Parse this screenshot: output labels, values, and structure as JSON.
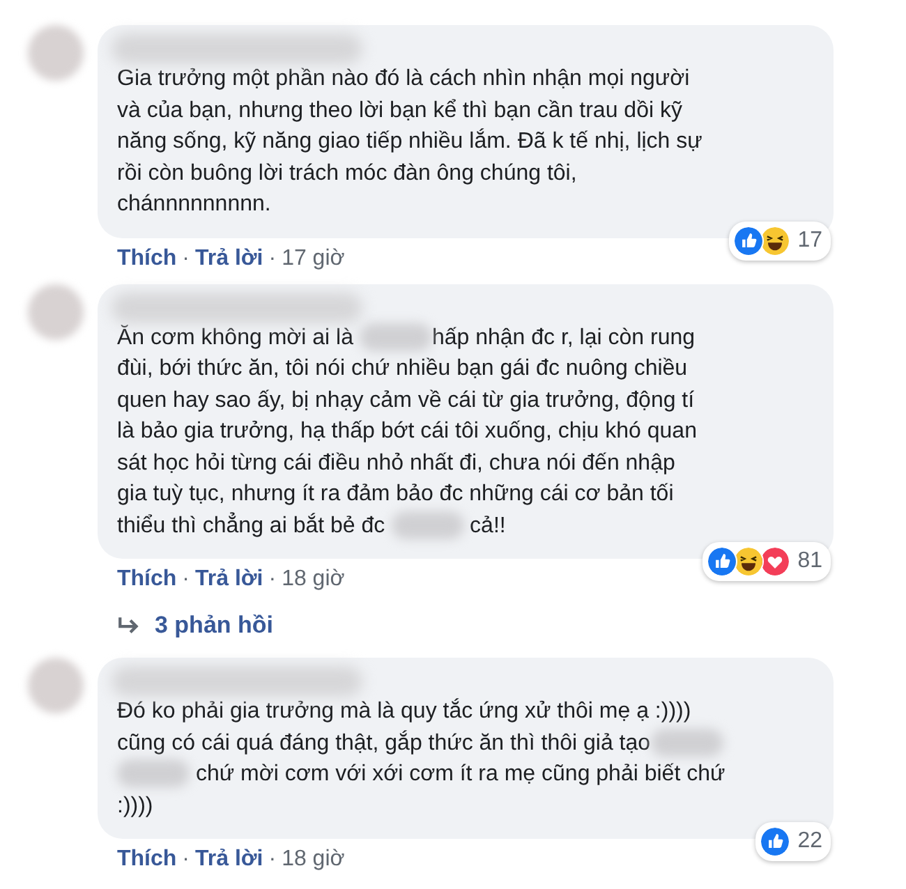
{
  "comments": [
    {
      "lines": [
        [
          {
            "kind": "text",
            "text": "Gia trưởng một phần nào đó là cách nhìn nhận mọi người"
          }
        ],
        [
          {
            "kind": "text",
            "text": "và của bạn, nhưng theo lời bạn kể thì bạn cần trau dồi kỹ"
          }
        ],
        [
          {
            "kind": "text",
            "text": "năng sống, kỹ năng giao tiếp nhiều lắm. Đã k tế nhị, lịch sự"
          }
        ],
        [
          {
            "kind": "text",
            "text": "rồi còn buông lời trách móc đàn ông chúng tôi,"
          }
        ],
        [
          {
            "kind": "text",
            "text": "chánnnnnnnnn."
          }
        ]
      ],
      "reactions": [
        {
          "kind": "like"
        },
        {
          "kind": "haha"
        }
      ],
      "reaction_count": "17",
      "actions": [
        "Thích",
        "Trả lời"
      ],
      "separator": "·",
      "time": "17 giờ"
    },
    {
      "lines": [
        [
          {
            "kind": "text",
            "text": "Ăn cơm không mời ai là "
          },
          {
            "kind": "blur"
          },
          {
            "kind": "text",
            "text": "hấp nhận đc r, lại còn rung"
          }
        ],
        [
          {
            "kind": "text",
            "text": "đùi, bới thức ăn, tôi nói chứ nhiều bạn gái đc nuông chiều"
          }
        ],
        [
          {
            "kind": "text",
            "text": "quen hay sao ấy, bị nhạy cảm về cái từ gia trưởng, động tí"
          }
        ],
        [
          {
            "kind": "text",
            "text": "là bảo gia trưởng, hạ thấp bớt cái tôi xuống, chịu khó quan"
          }
        ],
        [
          {
            "kind": "text",
            "text": "sát học hỏi từng cái điều nhỏ nhất đi, chưa nói đến nhập"
          }
        ],
        [
          {
            "kind": "text",
            "text": "gia tuỳ tục, nhưng ít ra đảm bảo đc những cái cơ bản tối"
          }
        ],
        [
          {
            "kind": "text",
            "text": "thiểu thì chẳng ai bắt bẻ đc "
          },
          {
            "kind": "blur"
          },
          {
            "kind": "text",
            "text": " cả!!"
          }
        ]
      ],
      "reactions": [
        {
          "kind": "like"
        },
        {
          "kind": "haha"
        },
        {
          "kind": "love"
        }
      ],
      "reaction_count": "81",
      "actions": [
        "Thích",
        "Trả lời"
      ],
      "separator": "·",
      "time": "18 giờ",
      "replies": "3 phản hồi"
    },
    {
      "lines": [
        [
          {
            "kind": "text",
            "text": "Đó ko phải gia trưởng mà là quy tắc ứng xử thôi mẹ ạ :))))"
          }
        ],
        [
          {
            "kind": "text",
            "text": "cũng có cái quá đáng thật, gắp thức ăn thì thôi giả tạo"
          },
          {
            "kind": "blur"
          }
        ],
        [
          {
            "kind": "blur"
          },
          {
            "kind": "text",
            "text": " chứ mời cơm với xới cơm ít ra mẹ cũng phải biết chứ"
          }
        ],
        [
          {
            "kind": "text",
            "text": ":))))"
          }
        ]
      ],
      "reactions": [
        {
          "kind": "like"
        }
      ],
      "reaction_count": "22",
      "actions": [
        "Thích",
        "Trả lời"
      ],
      "separator": "·",
      "time": "18 giờ"
    }
  ]
}
